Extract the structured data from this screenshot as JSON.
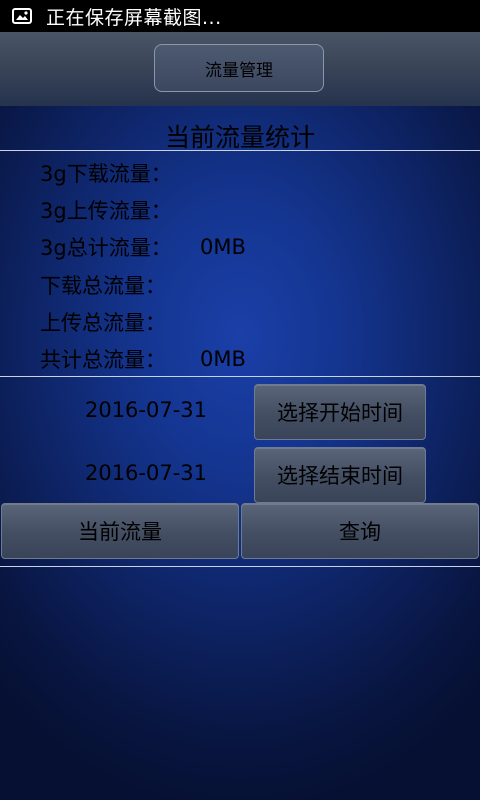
{
  "status_bar": {
    "icon": "screenshot-image-icon",
    "text": "正在保存屏幕截图..."
  },
  "header": {
    "tab_label": "流量管理"
  },
  "section": {
    "title": "当前流量统计"
  },
  "stats": [
    {
      "label": "3g下载流量：",
      "value": ""
    },
    {
      "label": "3g上传流量：",
      "value": ""
    },
    {
      "label": "3g总计流量：",
      "value": "0MB"
    },
    {
      "label": "下载总流量：",
      "value": ""
    },
    {
      "label": "上传总流量：",
      "value": ""
    },
    {
      "label": "共计总流量：",
      "value": "0MB"
    }
  ],
  "date_range": {
    "start_date": "2016-07-31",
    "start_button": "选择开始时间",
    "end_date": "2016-07-31",
    "end_button": "选择结束时间"
  },
  "actions": {
    "current_label": "当前流量",
    "query_label": "查询"
  }
}
